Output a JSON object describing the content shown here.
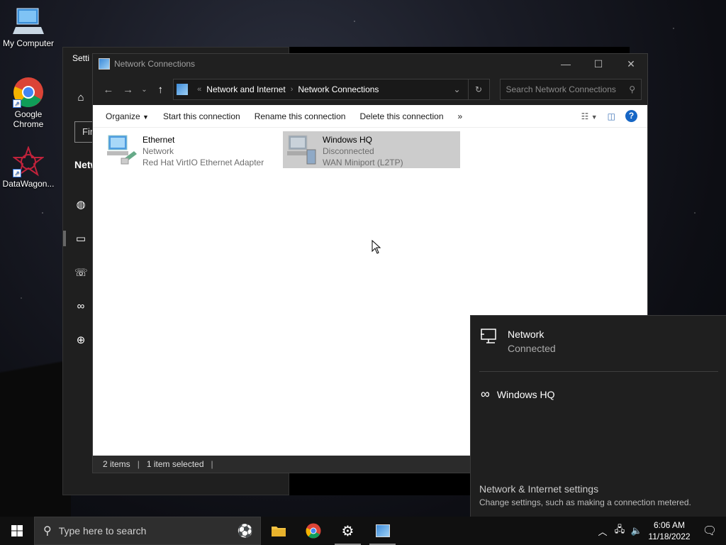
{
  "desktop": {
    "icons": [
      {
        "label": "My Computer"
      },
      {
        "label": "Google Chrome"
      },
      {
        "label": "DataWagon..."
      }
    ]
  },
  "settings_window": {
    "title": "Setti",
    "find_text": "Fin",
    "section": "Netw"
  },
  "explorer": {
    "title": "Network Connections",
    "breadcrumb": [
      "Network and Internet",
      "Network Connections"
    ],
    "search_placeholder": "Search Network Connections",
    "toolbar": {
      "organize": "Organize",
      "start": "Start this connection",
      "rename": "Rename this connection",
      "delete": "Delete this connection",
      "more": "»"
    },
    "connections": [
      {
        "name": "Ethernet",
        "status": "Network",
        "device": "Red Hat VirtIO Ethernet Adapter",
        "selected": false
      },
      {
        "name": "Windows HQ",
        "status": "Disconnected",
        "device": "WAN Miniport (L2TP)",
        "selected": true
      }
    ],
    "status": {
      "items": "2 items",
      "selected": "1 item selected"
    }
  },
  "flyout": {
    "network_title": "Network",
    "network_status": "Connected",
    "vpn_name": "Windows HQ",
    "settings_title": "Network & Internet settings",
    "settings_desc": "Change settings, such as making a connection metered."
  },
  "taskbar": {
    "search_placeholder": "Type here to search",
    "time": "6:06 AM",
    "date": "11/18/2022"
  },
  "colors": {
    "selection": "#cccccc",
    "dark_chrome": "#202020",
    "help_blue": "#1666c5"
  }
}
